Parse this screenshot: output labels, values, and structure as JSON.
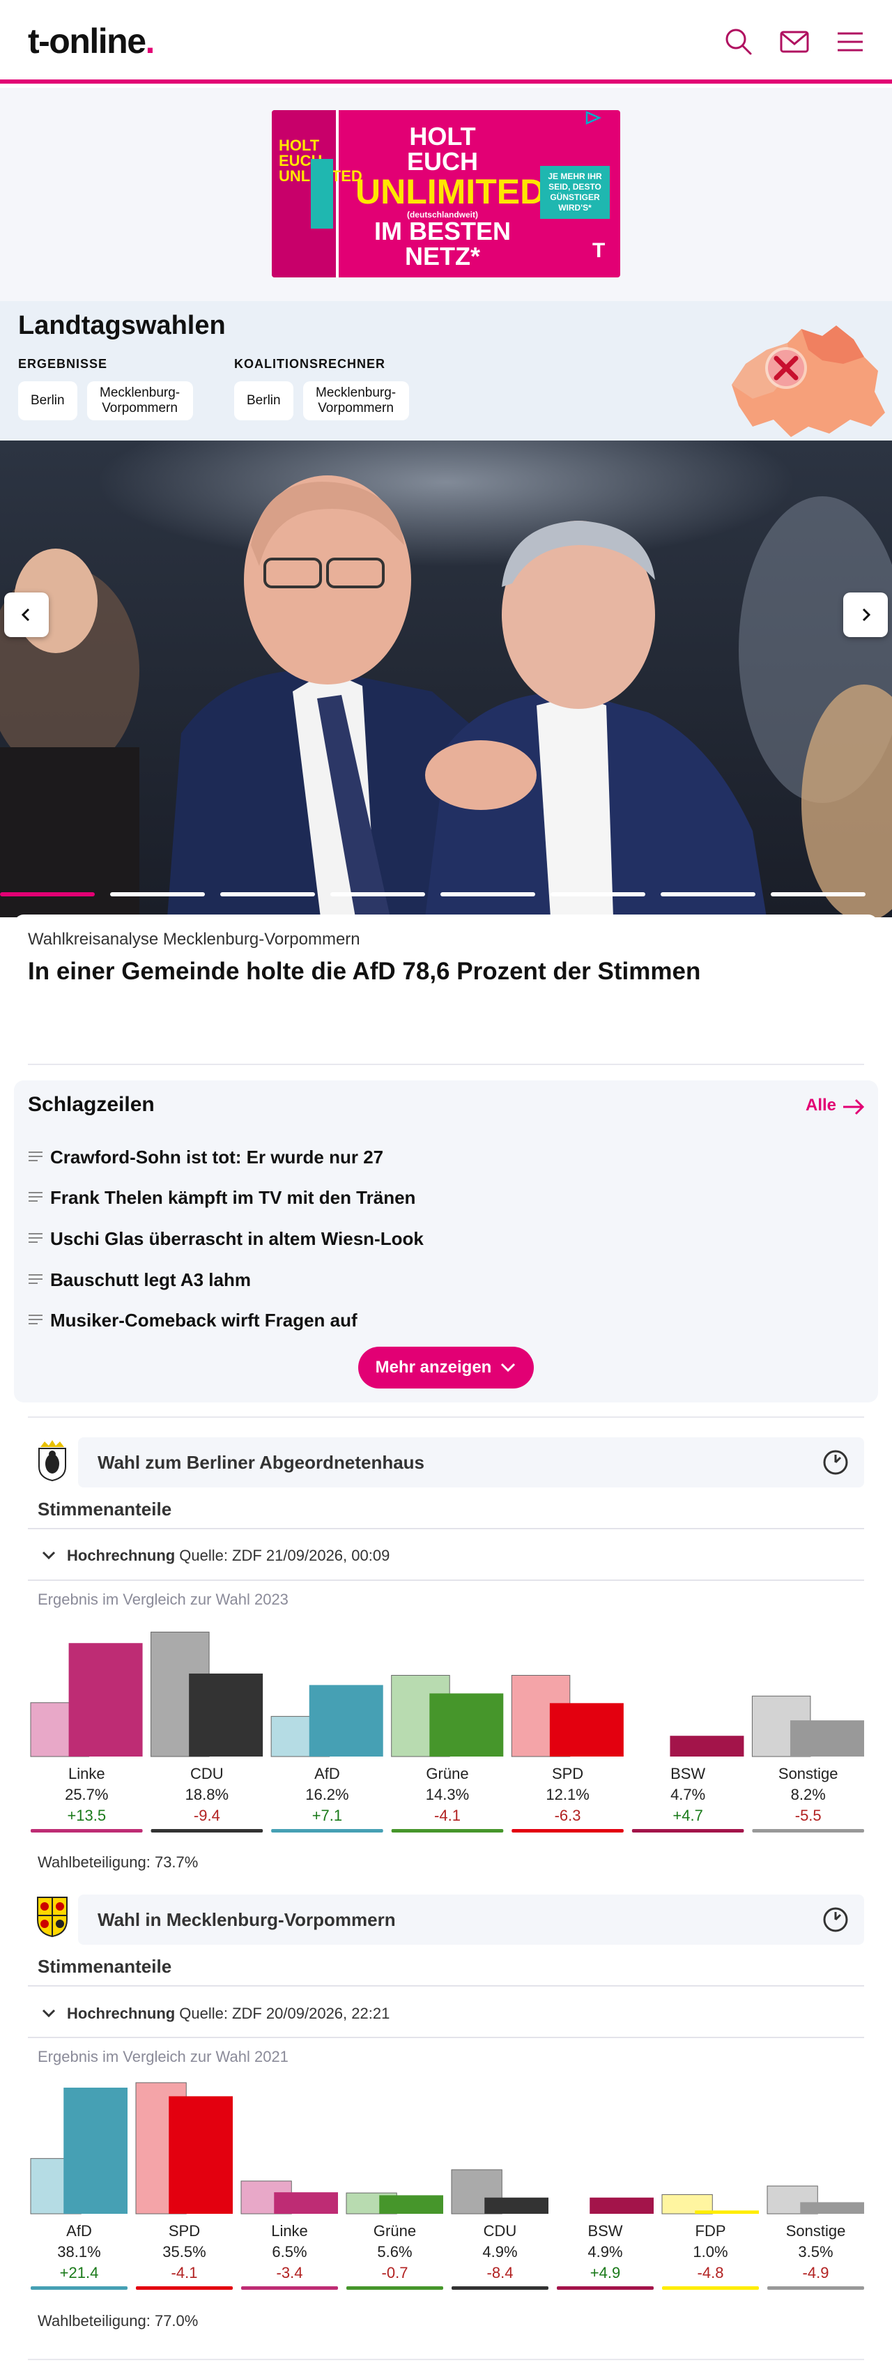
{
  "header": {
    "logo_text": "t-online",
    "logo_dot": ".",
    "icons": [
      "search-icon",
      "mail-icon",
      "menu-icon"
    ]
  },
  "ad": {
    "side_text": "HOLT EUCH UNLIMITED",
    "line1": "HOLT",
    "line2": "EUCH",
    "line3": "UNLIMITED",
    "line4": "(deutschlandweit)",
    "line5": "IM BESTEN",
    "line6": "NETZ*",
    "note": "JE MEHR IHR SEID, DESTO GÜNSTIGER WIRD'S*",
    "brand_mark": "T"
  },
  "landtagswahlen": {
    "title": "Landtagswahlen",
    "ergebnisse_label": "ERGEBNISSE",
    "koalition_label": "KOALITIONSRECHNER",
    "ergebnisse_buttons": [
      "Berlin",
      "Mecklenburg-Vorpommern"
    ],
    "koalition_buttons": [
      "Berlin",
      "Mecklenburg-Vorpommern"
    ]
  },
  "hero": {
    "kicker": "Wahlkreisanalyse Mecklenburg-Vorpommern",
    "title": "In einer Gemeinde holte die AfD 78,6 Prozent der Stimmen",
    "slide_count": 8,
    "active_slide": 1
  },
  "schlagzeilen": {
    "title": "Schlagzeilen",
    "all_label": "Alle",
    "items": [
      "Crawford-Sohn ist tot: Er wurde nur 27",
      "Frank Thelen kämpft im TV mit den Tränen",
      "Uschi Glas überrascht in altem Wiesn-Look",
      "Bauschutt legt A3 lahm",
      "Musiker-Comeback wirft Fragen auf"
    ],
    "more_label": "Mehr anzeigen"
  },
  "widgets": [
    {
      "title": "Wahl zum Berliner Abgeordnetenhaus",
      "subtitle": "Stimmenanteile",
      "hochrechnung_label": "Hochrechnung",
      "source": "Quelle: ZDF 21/09/2026, 00:09",
      "comparison_label": "Ergebnis im Vergleich zur Wahl 2023",
      "turnout": "Wahlbeteiligung: 73.7%"
    },
    {
      "title": "Wahl in Mecklenburg-Vorpommern",
      "subtitle": "Stimmenanteile",
      "hochrechnung_label": "Hochrechnung",
      "source": "Quelle: ZDF 20/09/2026, 22:21",
      "comparison_label": "Ergebnis im Vergleich zur Wahl 2021",
      "turnout": "Wahlbeteiligung: 77.0%"
    }
  ],
  "chart_data": [
    {
      "type": "bar",
      "categories": [
        "Linke",
        "CDU",
        "AfD",
        "Grüne",
        "SPD",
        "BSW",
        "Sonstige"
      ],
      "series": [
        {
          "name": "2023",
          "values": [
            12.2,
            28.2,
            9.1,
            18.4,
            18.4,
            0.0,
            13.7
          ]
        },
        {
          "name": "Hochrechnung",
          "values": [
            25.7,
            18.8,
            16.2,
            14.3,
            12.1,
            4.7,
            8.2
          ]
        }
      ],
      "value_labels": [
        "25.7%",
        "18.8%",
        "16.2%",
        "14.3%",
        "12.1%",
        "4.7%",
        "8.2%"
      ],
      "diff_labels": [
        "+13.5",
        "-9.4",
        "+7.1",
        "-4.1",
        "-6.3",
        "+4.7",
        "-5.5"
      ],
      "colors": [
        "#be2c74",
        "#333333",
        "#46a0b4",
        "#46962b",
        "#e3000f",
        "#a3144a",
        "#999999"
      ],
      "light_colors": [
        "#e8a8c8",
        "#aaaaaa",
        "#b5dce4",
        "#b8dbb0",
        "#f4a4a8",
        "#e0a0b4",
        "#d3d3d3"
      ],
      "diff_colors": [
        "#1a7a1a",
        "#b22222",
        "#1a7a1a",
        "#b22222",
        "#b22222",
        "#1a7a1a",
        "#b22222"
      ],
      "ylim": [
        0,
        30
      ]
    },
    {
      "type": "bar",
      "categories": [
        "AfD",
        "SPD",
        "Linke",
        "Grüne",
        "CDU",
        "BSW",
        "FDP",
        "Sonstige"
      ],
      "series": [
        {
          "name": "2021",
          "values": [
            16.7,
            39.6,
            9.9,
            6.3,
            13.3,
            0.0,
            5.8,
            8.4
          ]
        },
        {
          "name": "Hochrechnung",
          "values": [
            38.1,
            35.5,
            6.5,
            5.6,
            4.9,
            4.9,
            1.0,
            3.5
          ]
        }
      ],
      "value_labels": [
        "38.1%",
        "35.5%",
        "6.5%",
        "5.6%",
        "4.9%",
        "4.9%",
        "1.0%",
        "3.5%"
      ],
      "diff_labels": [
        "+21.4",
        "-4.1",
        "-3.4",
        "-0.7",
        "-8.4",
        "+4.9",
        "-4.8",
        "-4.9"
      ],
      "colors": [
        "#46a0b4",
        "#e3000f",
        "#be2c74",
        "#46962b",
        "#333333",
        "#a3144a",
        "#ffed00",
        "#999999"
      ],
      "light_colors": [
        "#b5dce4",
        "#f4a4a8",
        "#e8a8c8",
        "#b8dbb0",
        "#aaaaaa",
        "#e0a0b4",
        "#fff5a0",
        "#d3d3d3"
      ],
      "diff_colors": [
        "#1a7a1a",
        "#b22222",
        "#b22222",
        "#b22222",
        "#b22222",
        "#1a7a1a",
        "#b22222",
        "#b22222"
      ],
      "ylim": [
        0,
        40
      ]
    }
  ]
}
